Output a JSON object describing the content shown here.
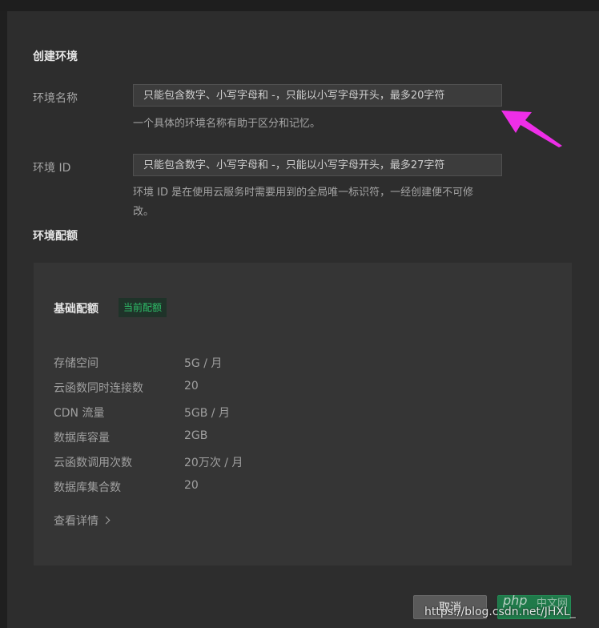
{
  "form": {
    "section_title": "创建环境",
    "env_name": {
      "label": "环境名称",
      "placeholder": "只能包含数字、小写字母和 -，只能以小写字母开头，最多20字符",
      "help": "一个具体的环境名称有助于区分和记忆。"
    },
    "env_id": {
      "label": "环境 ID",
      "placeholder": "只能包含数字、小写字母和 -，只能以小写字母开头，最多27字符",
      "help_line1": "环境 ID 是在使用云服务时需要用到的全局唯一标识符，一经创建便不可修",
      "help_line2": "改。"
    }
  },
  "quota": {
    "section_title": "环境配额",
    "plan_title": "基础配额",
    "badge": "当前配额",
    "specs": [
      {
        "label": "存储空间",
        "value": "5G / 月"
      },
      {
        "label": "云函数同时连接数",
        "value": "20"
      },
      {
        "label": "CDN 流量",
        "value": "5GB / 月"
      },
      {
        "label": "数据库容量",
        "value": "2GB"
      },
      {
        "label": "云函数调用次数",
        "value": "20万次 / 月"
      },
      {
        "label": "数据库集合数",
        "value": "20"
      }
    ],
    "details_link": "查看详情"
  },
  "footer": {
    "cancel_label": "取消",
    "confirm_label": ""
  },
  "watermark": {
    "brand": "php",
    "brand_cn": "中文网",
    "url": "https://blog.csdn.net/JHXL_"
  },
  "colors": {
    "background": "#2d2d2d",
    "panel": "#353535",
    "accent_green": "#2fbf6a",
    "annotation_arrow": "#ee2ee8"
  }
}
